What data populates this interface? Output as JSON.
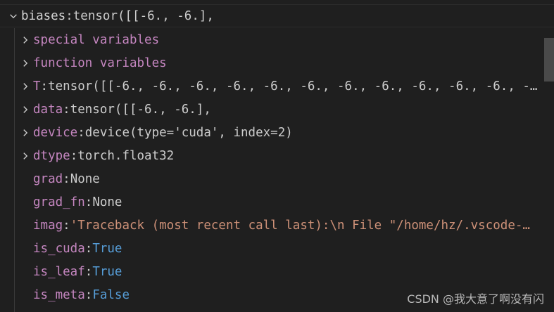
{
  "root": {
    "key": "biases",
    "sep": ": ",
    "value": "tensor([[-6., -6.],"
  },
  "rows": [
    {
      "key": "special variables",
      "value": "",
      "expandable": true
    },
    {
      "key": "function variables",
      "value": "",
      "expandable": true
    },
    {
      "key": "T",
      "value": "tensor([[-6., -6., -6., -6., -6., -6., -6., -6., -6., -6., -6., -…",
      "expandable": true,
      "kind": "plain"
    },
    {
      "key": "data",
      "value": "tensor([[-6., -6.],",
      "expandable": true,
      "kind": "plain"
    },
    {
      "key": "device",
      "value": "device(type='cuda', index=2)",
      "expandable": true,
      "kind": "plain"
    },
    {
      "key": "dtype",
      "value": "torch.float32",
      "expandable": true,
      "kind": "plain"
    },
    {
      "key": "grad",
      "value": "None",
      "expandable": false,
      "kind": "plain"
    },
    {
      "key": "grad_fn",
      "value": "None",
      "expandable": false,
      "kind": "plain"
    },
    {
      "key": "imag",
      "value": "'Traceback (most recent call last):\\n  File \"/home/hz/.vscode-…",
      "expandable": false,
      "kind": "str"
    },
    {
      "key": "is_cuda",
      "value": "True",
      "expandable": false,
      "kind": "bool"
    },
    {
      "key": "is_leaf",
      "value": "True",
      "expandable": false,
      "kind": "bool"
    },
    {
      "key": "is_meta",
      "value": "False",
      "expandable": false,
      "kind": "bool"
    }
  ],
  "watermark": "CSDN @我大意了啊没有闪",
  "icons": {
    "expanded": "chevron-down-icon",
    "collapsed": "chevron-right-icon"
  },
  "colors": {
    "background": "#1f1f1f",
    "key": "#c586c0",
    "string": "#ce9178",
    "bool": "#569cd6",
    "text": "#cccccc"
  }
}
